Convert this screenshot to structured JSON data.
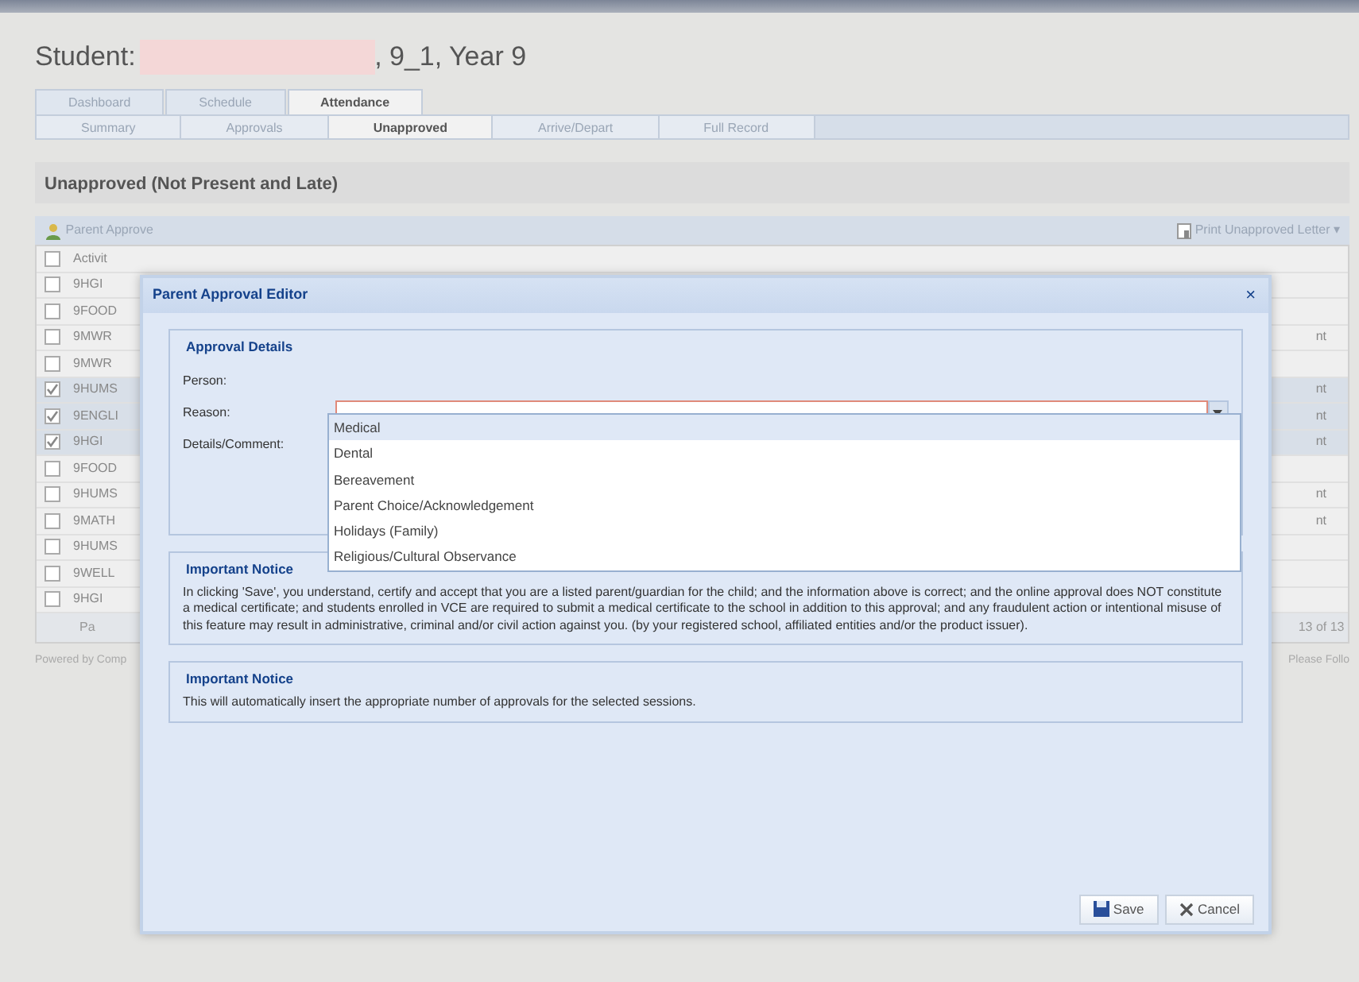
{
  "page_title": {
    "prefix": "Student:",
    "suffix": ", 9_1, Year 9"
  },
  "tabs": [
    {
      "label": "Dashboard",
      "selected": false
    },
    {
      "label": "Schedule",
      "selected": false
    },
    {
      "label": "Attendance",
      "selected": true
    }
  ],
  "subtabs": [
    {
      "label": "Summary",
      "selected": false
    },
    {
      "label": "Approvals",
      "selected": false
    },
    {
      "label": "Unapproved",
      "selected": true
    },
    {
      "label": "Arrive/Depart",
      "selected": false
    },
    {
      "label": "Full Record",
      "selected": false
    }
  ],
  "panel": {
    "title": "Unapproved (Not Present and Late)",
    "toolbar": {
      "left_button": "Parent Approve",
      "right_button": "Print Unapproved Letter ▾"
    },
    "grid": {
      "column_1": "Activit",
      "header_checked": false,
      "rows": [
        {
          "column_1": "9HGI",
          "checked": false
        },
        {
          "column_1": "9FOOD",
          "checked": false
        },
        {
          "column_1": "9MWR",
          "column_2": "nt",
          "checked": false
        },
        {
          "column_1": "9MWR",
          "checked": false
        },
        {
          "column_1": "9HUMS",
          "column_2": "nt",
          "checked": true
        },
        {
          "column_1": "9ENGLI",
          "column_2": "nt",
          "checked": true
        },
        {
          "column_1": "9HGI",
          "column_2": "nt",
          "checked": true
        },
        {
          "column_1": "9FOOD",
          "checked": false
        },
        {
          "column_1": "9HUMS",
          "column_2": "nt",
          "checked": false
        },
        {
          "column_1": "9MATH",
          "column_2": "nt",
          "checked": false
        },
        {
          "column_1": "9HUMS",
          "checked": false
        },
        {
          "column_1": "9WELL",
          "checked": false
        },
        {
          "column_1": "9HGI",
          "checked": false
        }
      ],
      "pager": {
        "left": "Pa",
        "right": "13 of 13"
      }
    }
  },
  "footer": {
    "left": "Powered by Comp",
    "right": "Please Follo"
  },
  "dialog": {
    "title": "Parent Approval Editor",
    "close": "×",
    "details": {
      "legend": "Approval Details",
      "person_label": "Person:",
      "reason_label": "Reason:",
      "comment_label": "Details/Comment:",
      "reason_invalid": true,
      "options": [
        {
          "label": "Medical",
          "selected": true
        },
        {
          "label": "Dental",
          "selected": false
        },
        {
          "label": "Bereavement",
          "selected": false
        },
        {
          "label": "Parent Choice/Acknowledgement",
          "selected": false
        },
        {
          "label": "Holidays (Family)",
          "selected": false
        },
        {
          "label": "Religious/Cultural Observance",
          "selected": false
        }
      ]
    },
    "notices": [
      {
        "legend": "Important Notice",
        "text": "In clicking 'Save', you understand, certify and accept that you are a listed parent/guardian for the child; and the information above is correct; and the online approval does NOT constitute a medical certificate; and students enrolled in VCE are required to submit a medical certificate to the school in addition to this approval; and any fraudulent action or intentional misuse of this feature may result in administrative, criminal and/or civil action against you. (by your registered school, affiliated entities and/or the product issuer)."
      },
      {
        "legend": "Important Notice",
        "text": "This will automatically insert the appropriate number of approvals for the selected sessions."
      }
    ],
    "buttons": [
      {
        "label": "Save",
        "kind": "save"
      },
      {
        "label": "Cancel",
        "kind": "cancel"
      }
    ]
  }
}
